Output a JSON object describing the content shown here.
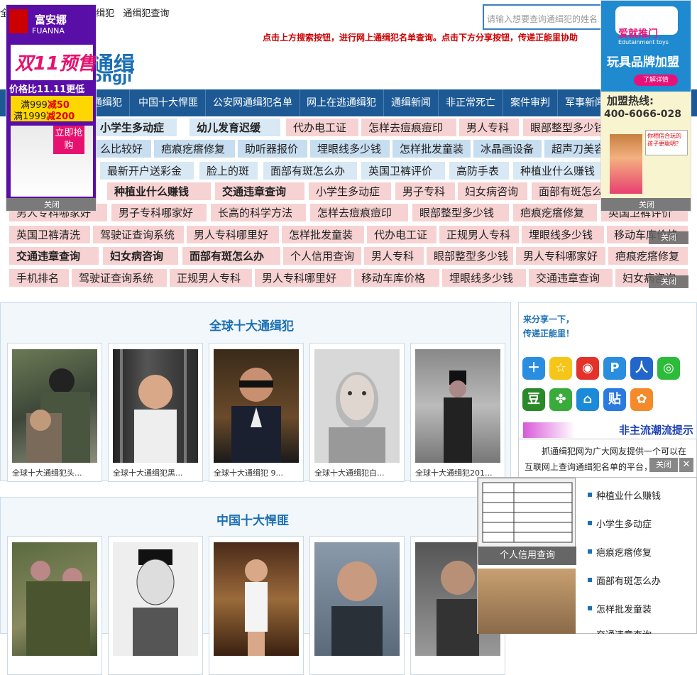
{
  "header": {
    "top_links": [
      "全",
      "缉犯",
      "通缉犯查询"
    ],
    "search_placeholder": "请输入想要查询通缉犯的姓名",
    "notice": "点击上方搜索按钮，进行网上通缉犯名单查询。点击下方分享按钮，传递正能里协助",
    "logo_text": "通缉",
    "logo_sub": "ongji"
  },
  "nav": [
    "通缉犯",
    "中国十大悍匪",
    "公安网通缉犯名单",
    "网上在逃通缉犯",
    "通缉新闻",
    "非正常死亡",
    "案件审判",
    "军事新闻"
  ],
  "keywords": {
    "row1": [
      "小学生多动症",
      "幼儿发育迟缓",
      "代办电工证",
      "怎样去痘痕痘印",
      "男人专科",
      "眼部整型多少钱"
    ],
    "row2": [
      "么比较好",
      "疤痕疙瘩修复",
      "助听器报价",
      "埋眼线多少钱",
      "怎样批发童装",
      "冰晶画设备",
      "超声刀美容"
    ],
    "row3": [
      "最新开户送彩金",
      "脸上的斑",
      "面部有斑怎么办",
      "英国卫裤评价",
      "高防手表",
      "种植业什么赚钱"
    ],
    "row4": [
      "种植业什么赚钱",
      "交通违章查询",
      "小学生多动症",
      "男子专科",
      "妇女病咨询",
      "面部有斑怎么"
    ],
    "row5": [
      "男人专科哪家好",
      "男子专科哪家好",
      "长高的科学方法",
      "怎样去痘痕痘印",
      "眼部整型多少钱",
      "疤痕疙瘩修复",
      "英国卫裤评价"
    ],
    "row6": [
      "英国卫裤清洗",
      "驾驶证查询系统",
      "男人专科哪里好",
      "怎样批发童装",
      "代办电工证",
      "正规男人专科",
      "埋眼线多少钱",
      "移动车库价格"
    ],
    "row7": [
      "交通违章查询",
      "妇女病咨询",
      "面部有斑怎么办",
      "个人信用查询",
      "男人专科",
      "眼部整型多少钱",
      "男人专科哪家好",
      "疤痕疙瘩修复"
    ],
    "row8": [
      "手机排名",
      "驾驶证查询系统",
      "正规男人专科",
      "男人专科哪里好",
      "移动车库价格",
      "埋眼线多少钱",
      "交通违章查询",
      "妇女病咨询"
    ]
  },
  "section1": {
    "title": "全球十大通缉犯",
    "cards": [
      "全球十大通缉犯头...",
      "全球十大通缉犯黑...",
      "全球十大通缉犯 9...",
      "全球十大通缉犯白...",
      "全球十大通缉犯201..."
    ]
  },
  "section2": {
    "title": "中国十大悍匪",
    "cards": [
      "",
      "",
      "",
      "",
      ""
    ]
  },
  "share": {
    "line1": "来分享一下，",
    "line2": "传递正能里！",
    "banner": "非主流潮流提示"
  },
  "about": {
    "text1": "抓通缉犯网为广大网友提供一个可以在",
    "text2": "互联网上查询通缉犯名单的平台，"
  },
  "left_ad": {
    "brand": "富安娜",
    "brand_en": "FUANNA",
    "headline": "双11预售",
    "price_line": "价格比11.11更低",
    "offer1_a": "满999",
    "offer1_b": "减50",
    "offer2_a": "满1999",
    "offer2_b": "减200",
    "cta": "立即抢购",
    "close": "关闭"
  },
  "right_ad": {
    "brand": "爱就推门",
    "brand_en": "Edutainment toys",
    "headline": "玩具品牌加盟",
    "btn": "了解详情",
    "hotline_label": "加盟热线:",
    "hotline": "400-6066-028",
    "bubble": "你相信合玩的孩子更聪明？",
    "close": "关闭"
  },
  "popup": {
    "caption": "个人信用查询",
    "close": "关闭",
    "list": [
      "种植业什么赚钱",
      "小学生多动症",
      "疤痕疙瘩修复",
      "面部有斑怎么办",
      "怎样批发童装",
      "交通违章查询"
    ]
  },
  "colors": {
    "nav_bg": "#1d5a95",
    "title_blue": "#1b6fb3",
    "notice_red": "#cc0000",
    "kw_pink": "#f7d2d2",
    "kw_blue": "#c7ddf0"
  }
}
